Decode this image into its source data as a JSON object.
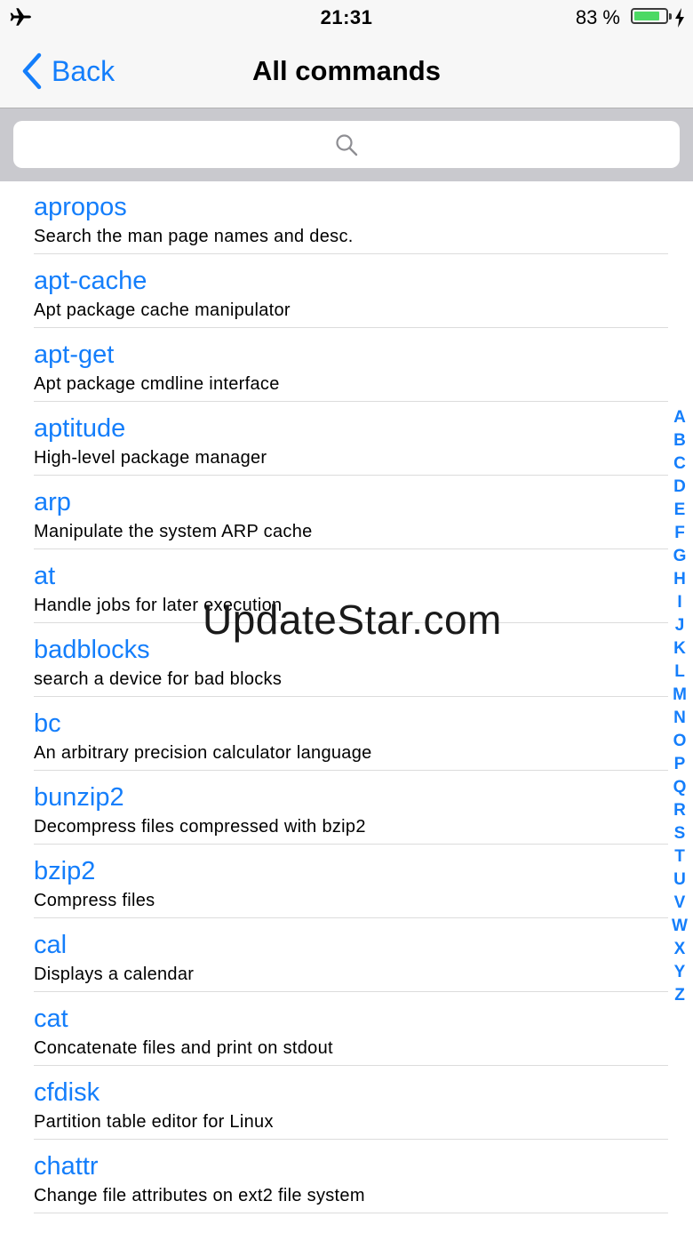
{
  "status": {
    "time": "21:31",
    "battery": "83 %",
    "battery_level": 0.83,
    "icons": [
      "airplane-icon",
      "battery-icon",
      "charging-bolt-icon"
    ]
  },
  "nav": {
    "back_label": "Back",
    "title": "All commands"
  },
  "search": {
    "placeholder": "",
    "icon": "search-icon"
  },
  "commands": [
    {
      "name": "apropos",
      "desc": "Search the man page names and desc."
    },
    {
      "name": "apt-cache",
      "desc": "Apt package cache manipulator"
    },
    {
      "name": "apt-get",
      "desc": "Apt package cmdline interface"
    },
    {
      "name": "aptitude",
      "desc": "High-level package manager"
    },
    {
      "name": "arp",
      "desc": "Manipulate the system ARP cache"
    },
    {
      "name": "at",
      "desc": "Handle jobs for later execution"
    },
    {
      "name": "badblocks",
      "desc": "search a device for bad blocks"
    },
    {
      "name": "bc",
      "desc": "An arbitrary precision calculator language"
    },
    {
      "name": "bunzip2",
      "desc": "Decompress files compressed with bzip2"
    },
    {
      "name": "bzip2",
      "desc": "Compress files"
    },
    {
      "name": "cal",
      "desc": "Displays a calendar"
    },
    {
      "name": "cat",
      "desc": "Concatenate files and print on stdout"
    },
    {
      "name": "cfdisk",
      "desc": "Partition table editor for Linux"
    },
    {
      "name": "chattr",
      "desc": "Change file attributes on ext2 file system"
    }
  ],
  "index_letters": [
    "A",
    "B",
    "C",
    "D",
    "E",
    "F",
    "G",
    "H",
    "I",
    "J",
    "K",
    "L",
    "M",
    "N",
    "O",
    "P",
    "Q",
    "R",
    "S",
    "T",
    "U",
    "V",
    "W",
    "X",
    "Y",
    "Z"
  ],
  "watermark": "UpdateStar.com",
  "colors": {
    "accent": "#147efb",
    "battery_fill": "#4cd964",
    "search_bar_bg": "#c9c9ce"
  }
}
